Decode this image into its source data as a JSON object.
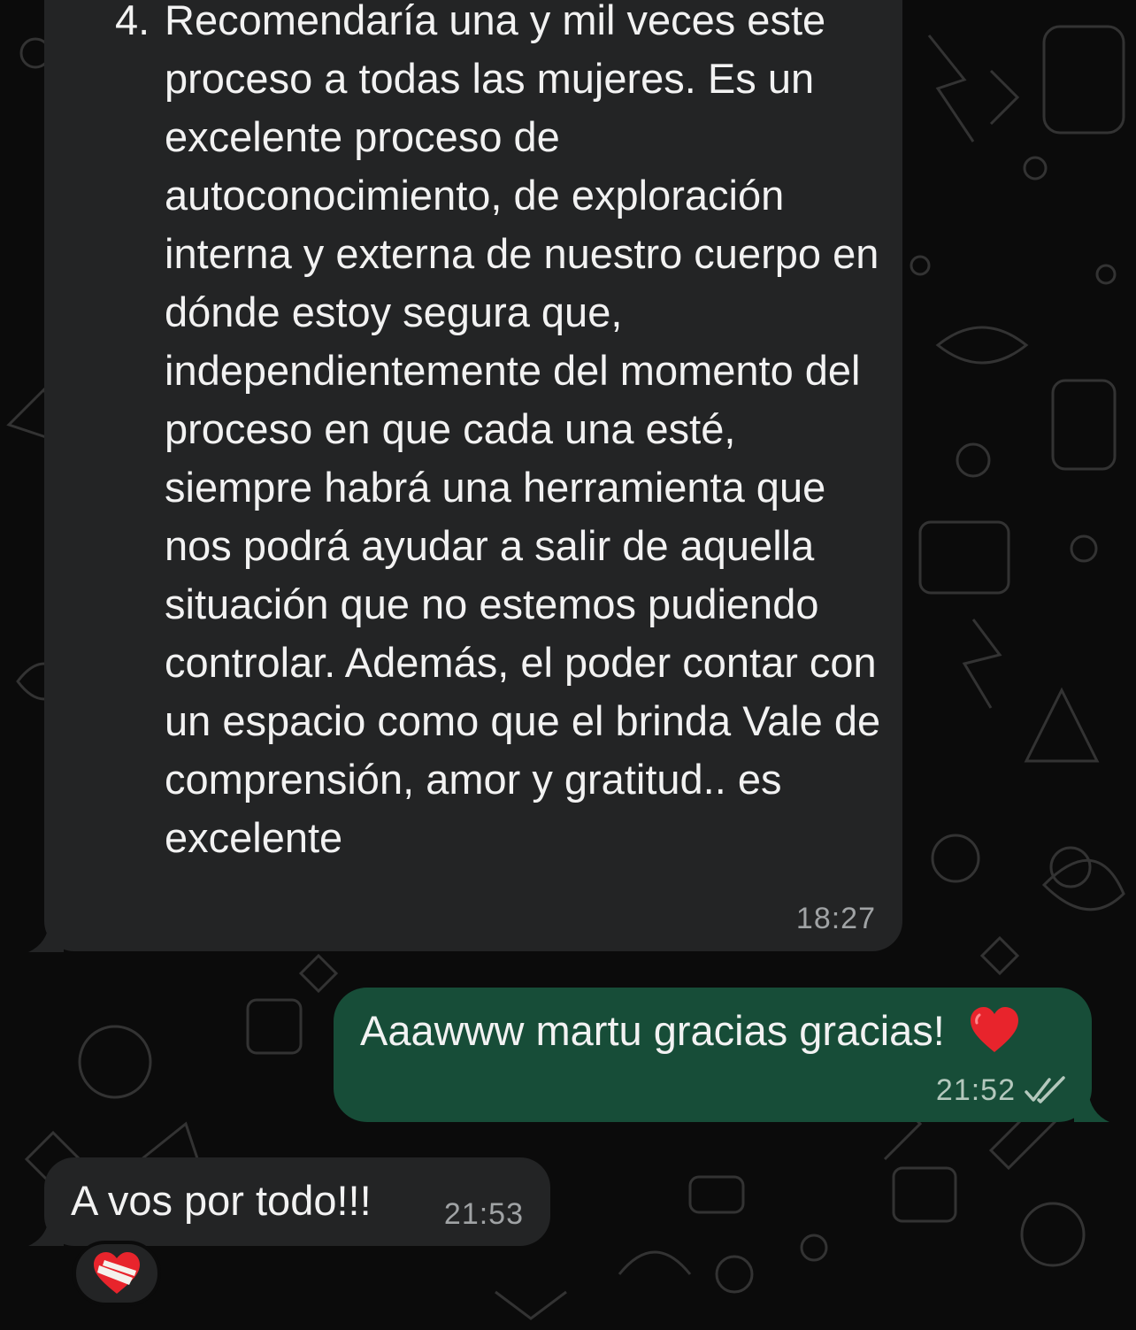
{
  "messages": {
    "first": {
      "number": "4.",
      "text": "Recomendaría una y mil veces este proceso a todas las mujeres. Es un excelente proceso de autoconocimiento, de exploración interna y externa de nuestro cuerpo en dónde estoy segura que, independientemente del momento del proceso en que cada una esté, siempre habrá una herramienta que nos podrá ayudar a salir de aquella situación que no estemos pudiendo controlar. Además, el poder contar con un espacio como que el brinda Vale de comprensión, amor y gratitud.. es excelente",
      "time": "18:27"
    },
    "second": {
      "text": "Aaawww martu gracias gracias!",
      "emoji": "red-heart-icon",
      "time": "21:52",
      "status": "read-double-check-icon"
    },
    "third": {
      "text": "A vos por todo!!!",
      "time": "21:53",
      "reaction": "mending-heart-icon"
    }
  },
  "colors": {
    "background": "#0b0b0b",
    "incoming_bubble": "#232425",
    "outgoing_bubble": "#174d38",
    "text": "#f2f2f2"
  }
}
